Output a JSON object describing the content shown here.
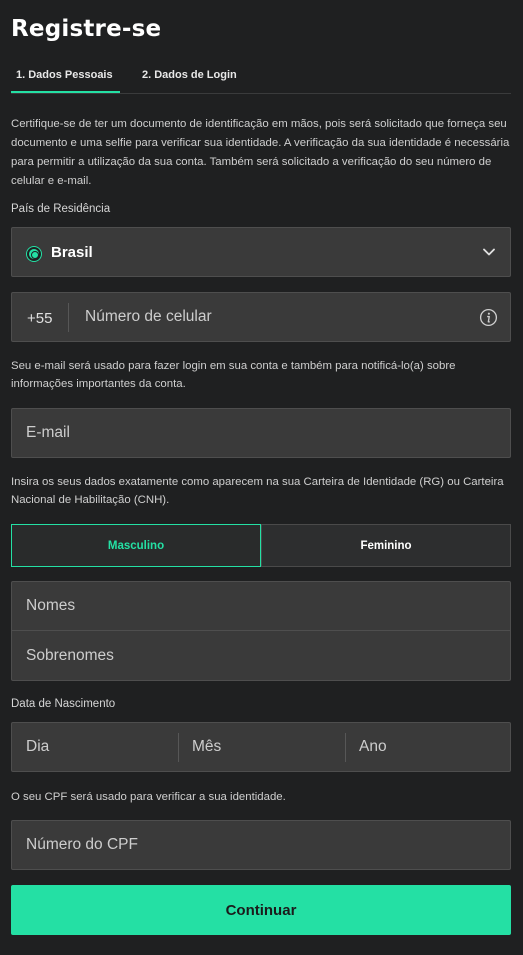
{
  "title": "Registre-se",
  "tabs": [
    {
      "label": "1. Dados Pessoais",
      "active": true
    },
    {
      "label": "2. Dados de Login",
      "active": false
    }
  ],
  "intro_text": "Certifique-se de ter um documento de identificação em mãos, pois será solicitado que forneça seu documento e uma selfie para verificar sua identidade. A verificação da sua identidade é necessária para permitir a utilização da sua conta. Também será solicitado a verificação do seu número de celular e e-mail.",
  "country": {
    "label": "País de Residência",
    "selected": "Brasil",
    "icon": "brazil-flag-icon"
  },
  "phone": {
    "code": "+55",
    "placeholder": "Número de celular",
    "info_icon": "info-icon"
  },
  "email_note": "Seu e-mail será usado para fazer login em sua conta e também para notificá-lo(a) sobre informações importantes da conta.",
  "email": {
    "placeholder": "E-mail"
  },
  "id_note": "Insira os seus dados exatamente como aparecem na sua Carteira de Identidade (RG) ou Carteira Nacional de Habilitação (CNH).",
  "gender": {
    "male": "Masculino",
    "female": "Feminino",
    "selected": "Masculino"
  },
  "names": {
    "first_placeholder": "Nomes",
    "last_placeholder": "Sobrenomes"
  },
  "birth": {
    "label": "Data de Nascimento",
    "day_placeholder": "Dia",
    "month_placeholder": "Mês",
    "year_placeholder": "Ano"
  },
  "cpf_note": "O seu CPF será usado para verificar a sua identidade.",
  "cpf": {
    "placeholder": "Número do CPF"
  },
  "continue_label": "Continuar",
  "colors": {
    "accent": "#24e0a4",
    "background": "#1f2021",
    "field": "#3a3a3a"
  }
}
